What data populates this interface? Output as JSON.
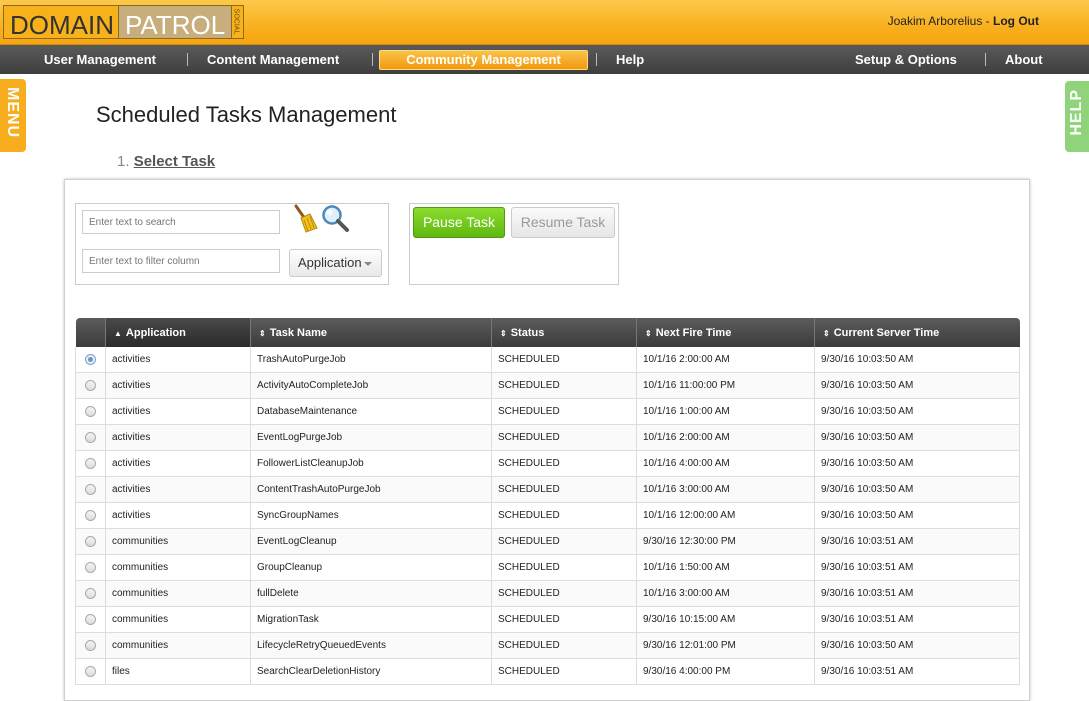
{
  "header": {
    "logo_domain": "DOMAIN",
    "logo_patrol": "PATROL",
    "logo_social": "SOCIAL",
    "user_name": "Joakim Arborelius",
    "separator": " - ",
    "logout_label": "Log Out"
  },
  "nav": {
    "user_management": "User Management",
    "content_management": "Content Management",
    "community_management": "Community Management",
    "help": "Help",
    "setup_options": "Setup & Options",
    "about": "About"
  },
  "side_tabs": {
    "menu": "MENU",
    "help": "HELP"
  },
  "page": {
    "title": "Scheduled Tasks Management",
    "step_number": "1.",
    "step_label": "Select Task"
  },
  "filters": {
    "search_placeholder": "Enter text to search",
    "filter_placeholder": "Enter text to filter column",
    "column_select_label": "Application"
  },
  "actions": {
    "pause_label": "Pause Task",
    "resume_label": "Resume Task"
  },
  "table": {
    "headers": [
      "Application",
      "Task Name",
      "Status",
      "Next Fire Time",
      "Current Server Time"
    ],
    "sort_glyph_sorted": "▲",
    "sort_glyph": "⇕",
    "rows": [
      {
        "application": "activities",
        "task": "TrashAutoPurgeJob",
        "status": "SCHEDULED",
        "next": "10/1/16 2:00:00 AM",
        "server": "9/30/16 10:03:50 AM",
        "selected": true
      },
      {
        "application": "activities",
        "task": "ActivityAutoCompleteJob",
        "status": "SCHEDULED",
        "next": "10/1/16 11:00:00 PM",
        "server": "9/30/16 10:03:50 AM",
        "selected": false
      },
      {
        "application": "activities",
        "task": "DatabaseMaintenance",
        "status": "SCHEDULED",
        "next": "10/1/16 1:00:00 AM",
        "server": "9/30/16 10:03:50 AM",
        "selected": false
      },
      {
        "application": "activities",
        "task": "EventLogPurgeJob",
        "status": "SCHEDULED",
        "next": "10/1/16 2:00:00 AM",
        "server": "9/30/16 10:03:50 AM",
        "selected": false
      },
      {
        "application": "activities",
        "task": "FollowerListCleanupJob",
        "status": "SCHEDULED",
        "next": "10/1/16 4:00:00 AM",
        "server": "9/30/16 10:03:50 AM",
        "selected": false
      },
      {
        "application": "activities",
        "task": "ContentTrashAutoPurgeJob",
        "status": "SCHEDULED",
        "next": "10/1/16 3:00:00 AM",
        "server": "9/30/16 10:03:50 AM",
        "selected": false
      },
      {
        "application": "activities",
        "task": "SyncGroupNames",
        "status": "SCHEDULED",
        "next": "10/1/16 12:00:00 AM",
        "server": "9/30/16 10:03:50 AM",
        "selected": false
      },
      {
        "application": "communities",
        "task": "EventLogCleanup",
        "status": "SCHEDULED",
        "next": "9/30/16 12:30:00 PM",
        "server": "9/30/16 10:03:51 AM",
        "selected": false
      },
      {
        "application": "communities",
        "task": "GroupCleanup",
        "status": "SCHEDULED",
        "next": "10/1/16 1:50:00 AM",
        "server": "9/30/16 10:03:51 AM",
        "selected": false
      },
      {
        "application": "communities",
        "task": "fullDelete",
        "status": "SCHEDULED",
        "next": "10/1/16 3:00:00 AM",
        "server": "9/30/16 10:03:51 AM",
        "selected": false
      },
      {
        "application": "communities",
        "task": "MigrationTask",
        "status": "SCHEDULED",
        "next": "9/30/16 10:15:00 AM",
        "server": "9/30/16 10:03:51 AM",
        "selected": false
      },
      {
        "application": "communities",
        "task": "LifecycleRetryQueuedEvents",
        "status": "SCHEDULED",
        "next": "9/30/16 12:01:00 PM",
        "server": "9/30/16 10:03:50 AM",
        "selected": false
      },
      {
        "application": "files",
        "task": "SearchClearDeletionHistory",
        "status": "SCHEDULED",
        "next": "9/30/16 4:00:00 PM",
        "server": "9/30/16 10:03:51 AM",
        "selected": false
      }
    ]
  },
  "colors": {
    "brand_orange": "#f7b21b",
    "nav_dark": "#3e3e3e",
    "pause_green": "#5fb811",
    "help_green": "#8fd37a"
  }
}
